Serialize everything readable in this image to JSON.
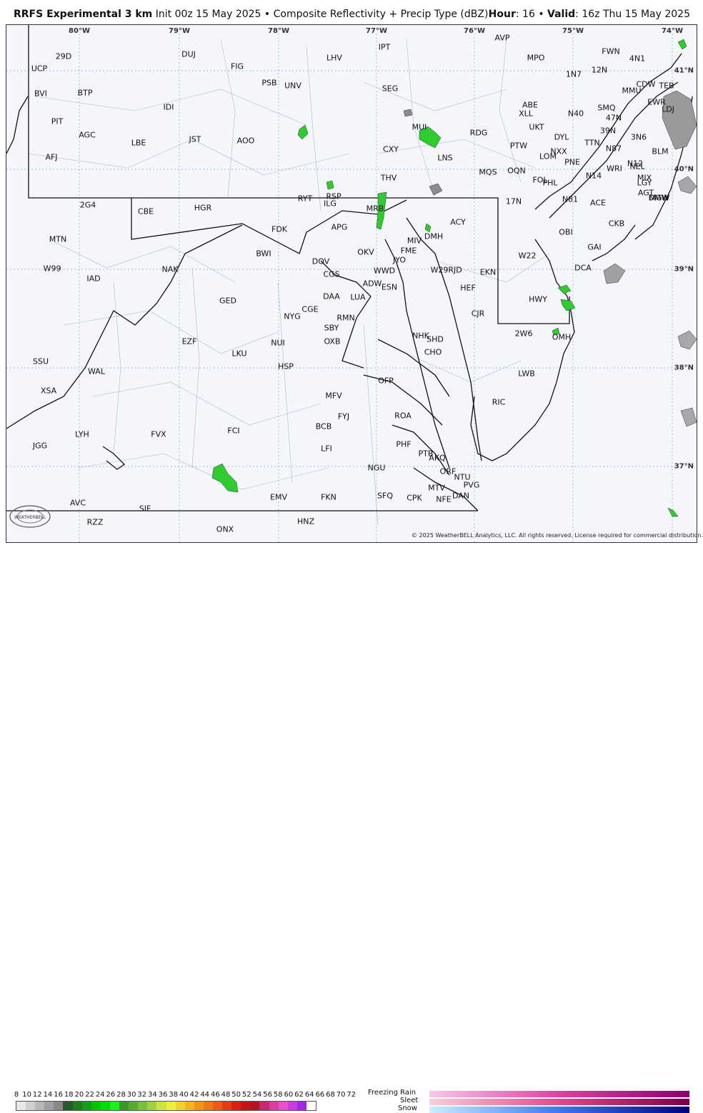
{
  "header": {
    "model": "RRFS Experimental 3 km",
    "init": "Init 00z 15 May 2025",
    "separator": "•",
    "product": "Composite Reflectivity + Precip Type (dBZ)",
    "hour_label": "Hour",
    "hour_value": ": 16",
    "valid_label": "Valid",
    "valid_value": ": 16z Thu 15 May 2025"
  },
  "longitudes": [
    "80°W",
    "79°W",
    "78°W",
    "77°W",
    "76°W",
    "75°W",
    "74°W"
  ],
  "latitudes": [
    "41°N",
    "40°N",
    "39°N",
    "38°N",
    "37°N"
  ],
  "stations": [
    "29D",
    "UCP",
    "DUJ",
    "FIG",
    "LHV",
    "IPT",
    "AVP",
    "MPO",
    "FWN",
    "4N1",
    "BVI",
    "BTP",
    "PSB",
    "UNV",
    "SEG",
    "1N7",
    "12N",
    "CDW",
    "TEB",
    "MMU",
    "EWR",
    "LDJ",
    "IDI",
    "ABE",
    "XLL",
    "SMQ",
    "N40",
    "47N",
    "PIT",
    "MUI",
    "UKT",
    "39N",
    "AGC",
    "LBE",
    "JST",
    "AOO",
    "RDG",
    "DYL",
    "TTN",
    "N87",
    "3N6",
    "BLM",
    "PTW",
    "NXX",
    "AFJ",
    "CXY",
    "LNS",
    "LOM",
    "PNE",
    "N12",
    "THV",
    "MQS",
    "OQN",
    "WRI",
    "NEL",
    "FOL",
    "PHL",
    "N14",
    "MIX",
    "LGY",
    "AGT",
    "MGW",
    "2G4",
    "CBE",
    "HGR",
    "RYT",
    "RSP",
    "ILG",
    "17N",
    "N81",
    "ACE",
    "DMW",
    "MRB",
    "FDK",
    "APG",
    "ACY",
    "CKB",
    "MTN",
    "DMH",
    "MIV",
    "OBI",
    "GAI",
    "OKV",
    "BWI",
    "FME",
    "JYO",
    "DOV",
    "W22",
    "W99",
    "NAK",
    "W29",
    "RJD",
    "EKN",
    "IAD",
    "CGS",
    "WWD",
    "DCA",
    "ADW",
    "ESN",
    "HEF",
    "DAA",
    "LUA",
    "GED",
    "HWY",
    "CGE",
    "CJR",
    "NYG",
    "RMN",
    "SBY",
    "2W6",
    "NHK",
    "SHD",
    "EZF",
    "OXB",
    "OMH",
    "NUI",
    "CHO",
    "LKU",
    "HSP",
    "WAL",
    "LWB",
    "SSU",
    "XSA",
    "OFP",
    "MFV",
    "RIC",
    "FYJ",
    "ROA",
    "LYH",
    "FVX",
    "FCI",
    "BCB",
    "JGG",
    "PHF",
    "PTB",
    "LFI",
    "AKQ",
    "NGU",
    "ORF",
    "NTU",
    "PVG",
    "MTV",
    "AVC",
    "EMV",
    "FKN",
    "SFQ",
    "CPK",
    "NFE",
    "DAN",
    "SIF",
    "RZZ",
    "HNZ",
    "ONX"
  ],
  "copyright": "© 2025 WeatherBELL Analytics, LLC. All rights reserved. License required for commercial distribution.",
  "logo_text": "WEATHERBELL",
  "legend": {
    "scale_values": [
      "8",
      "10",
      "12",
      "14",
      "16",
      "18",
      "20",
      "22",
      "24",
      "26",
      "28",
      "30",
      "32",
      "34",
      "36",
      "38",
      "40",
      "42",
      "44",
      "46",
      "48",
      "50",
      "52",
      "54",
      "56",
      "58",
      "60",
      "62",
      "64",
      "66",
      "68",
      "70",
      "72"
    ],
    "scale_colors": [
      "#e8e8e8",
      "#d0d0d0",
      "#b8b8b8",
      "#a0a0a0",
      "#888888",
      "#2a5a2a",
      "#1e7d1e",
      "#14a014",
      "#00c800",
      "#00dc00",
      "#1ef01e",
      "#3c9628",
      "#58aa32",
      "#78be3c",
      "#a0d23c",
      "#c8e63c",
      "#f0f03c",
      "#f0d22c",
      "#f0b41e",
      "#f09614",
      "#f07814",
      "#f05a14",
      "#e63c14",
      "#dc1e14",
      "#c81414",
      "#b41428",
      "#c8286e",
      "#dc3ca0",
      "#e650c8",
      "#c83cdc",
      "#a028e6",
      "#ffffff"
    ],
    "ptype_labels": [
      "Freezing Rain",
      "Sleet",
      "Snow"
    ],
    "ptype_colors": {
      "freezing_rain": [
        "#f8c8e8",
        "#e040a0",
        "#8a006e"
      ],
      "sleet": [
        "#f8d0d8",
        "#e04a8a",
        "#7a0046"
      ],
      "snow": [
        "#c8f0ff",
        "#3c78f0",
        "#000080"
      ]
    }
  }
}
